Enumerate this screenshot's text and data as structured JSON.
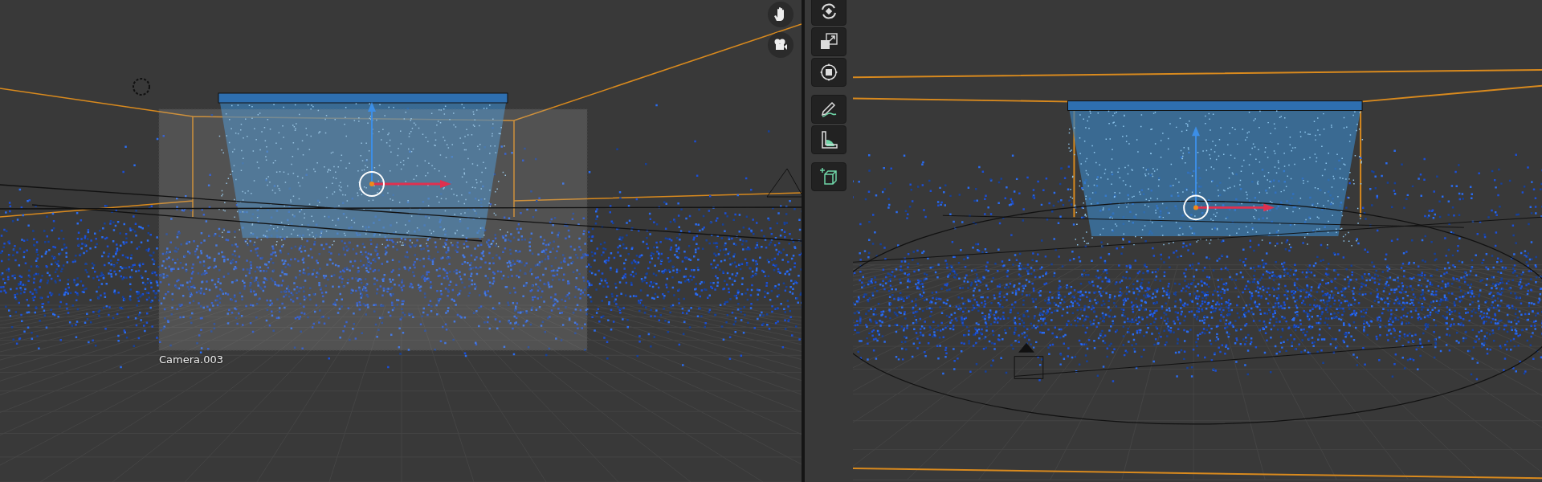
{
  "left_viewport": {
    "camera_label": "Camera.003",
    "nav_buttons": [
      {
        "kind": "hand"
      },
      {
        "kind": "camera"
      }
    ]
  },
  "right_viewport": {
    "tools": [
      {
        "kind": "rotate"
      },
      {
        "kind": "scale"
      },
      {
        "kind": "transform"
      },
      {
        "kind": "annotate"
      },
      {
        "kind": "measure"
      },
      {
        "kind": "add-cube"
      }
    ]
  }
}
